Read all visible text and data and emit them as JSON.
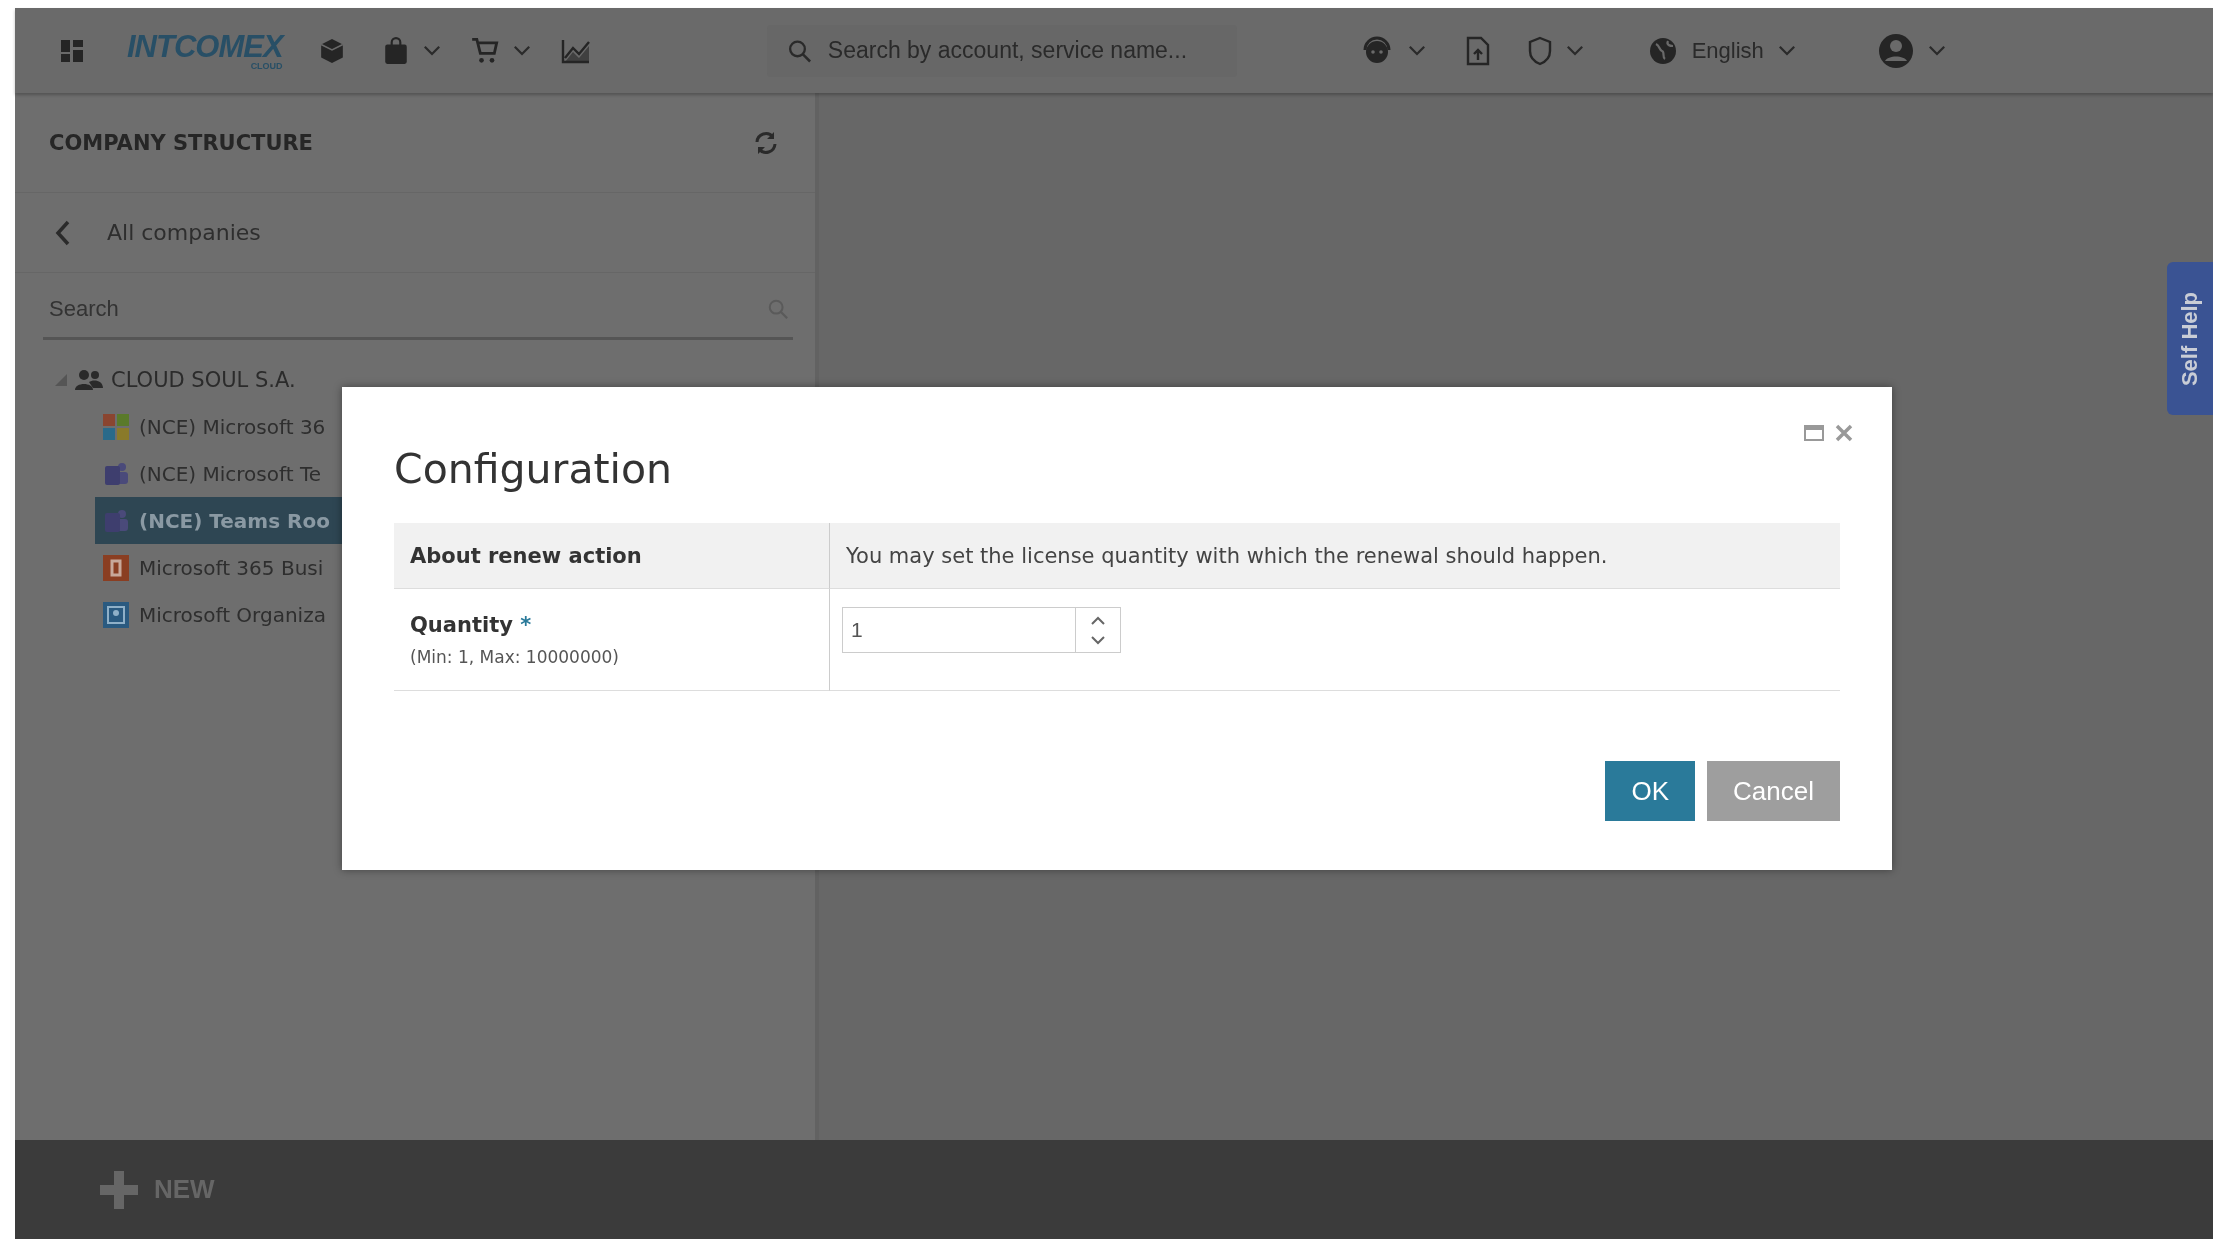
{
  "topbar": {
    "logo": {
      "name": "INTCOMEX",
      "sub": "CLOUD"
    },
    "search": {
      "placeholder": "Search by account, service name..."
    },
    "language": "English"
  },
  "sidebar": {
    "title": "COMPANY STRUCTURE",
    "back": "All companies",
    "search": {
      "placeholder": "Search"
    },
    "tree": [
      {
        "label": "CLOUD SOUL S.A.",
        "expanded": true,
        "children": [
          {
            "label": "(NCE) Microsoft 36",
            "kind": "windows",
            "selected": false
          },
          {
            "label": "(NCE) Microsoft Te",
            "kind": "teams",
            "selected": false
          },
          {
            "label": "(NCE) Teams Roo",
            "kind": "teams",
            "selected": true
          },
          {
            "label": "Microsoft 365 Busi",
            "kind": "office",
            "selected": false
          },
          {
            "label": "Microsoft Organiza",
            "kind": "org",
            "selected": false
          }
        ]
      }
    ]
  },
  "self_help": "Self Help",
  "bottom_bar": {
    "new_button": "NEW"
  },
  "dialog": {
    "title": "Configuration",
    "info": {
      "label": "About renew action",
      "text": "You may set the license quantity with which the renewal should happen."
    },
    "quantity": {
      "label": "Quantity",
      "required": true,
      "required_mark": "*",
      "hint": "(Min: 1, Max: 10000000)",
      "value": "1"
    },
    "buttons": [
      {
        "label": "OK",
        "kind": "primary"
      },
      {
        "label": "Cancel",
        "kind": "secondary"
      }
    ]
  }
}
